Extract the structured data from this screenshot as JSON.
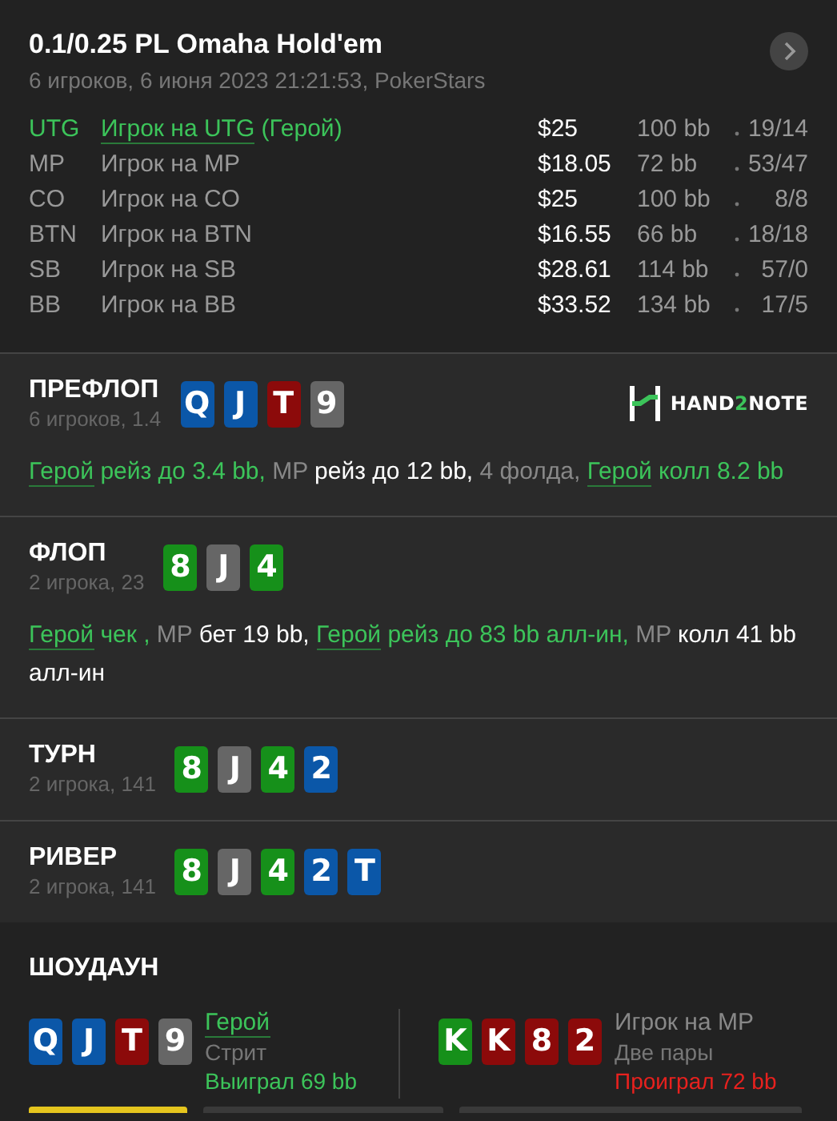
{
  "header": {
    "title": "0.1/0.25 PL Omaha Hold'em",
    "subtitle": "6 игроков, 6 июня 2023 21:21:53, PokerStars"
  },
  "players": [
    {
      "position": "UTG",
      "name": "Игрок на UTG",
      "suffix": "(Герой)",
      "hero": true,
      "stack": "$25",
      "bb": "100 bb",
      "stats": "19/14"
    },
    {
      "position": "MP",
      "name": "Игрок на MP",
      "hero": false,
      "stack": "$18.05",
      "bb": "72 bb",
      "stats": "53/47"
    },
    {
      "position": "CO",
      "name": "Игрок на CO",
      "hero": false,
      "stack": "$25",
      "bb": "100 bb",
      "stats": "8/8"
    },
    {
      "position": "BTN",
      "name": "Игрок на BTN",
      "hero": false,
      "stack": "$16.55",
      "bb": "66 bb",
      "stats": "18/18"
    },
    {
      "position": "SB",
      "name": "Игрок на SB",
      "hero": false,
      "stack": "$28.61",
      "bb": "114 bb",
      "stats": "57/0"
    },
    {
      "position": "BB",
      "name": "Игрок на BB",
      "hero": false,
      "stack": "$33.52",
      "bb": "134 bb",
      "stats": "17/5"
    }
  ],
  "streets": [
    {
      "name": "ПРЕФЛОП",
      "info": "6 игроков, 1.4",
      "logo": {
        "prefix": "HAND",
        "accent": "2",
        "suffix": "NOTE"
      },
      "cards": [
        {
          "rank": "Q",
          "color": "#0b57a8"
        },
        {
          "rank": "J",
          "color": "#0b57a8"
        },
        {
          "rank": "T",
          "color": "#8c0a0a"
        },
        {
          "rank": "9",
          "color": "#666666"
        }
      ],
      "actions": [
        {
          "kind": "link",
          "text": "Герой"
        },
        {
          "kind": "green",
          "text": " рейз до 3.4 bb,"
        },
        {
          "kind": "grey",
          "text": " MP"
        },
        {
          "kind": "white",
          "text": " рейз до 12 bb,"
        },
        {
          "kind": "grey",
          "text": " 4 фолда, "
        },
        {
          "kind": "link",
          "text": "Герой"
        },
        {
          "kind": "green",
          "text": " колл 8.2 bb"
        }
      ]
    },
    {
      "name": "ФЛОП",
      "info": "2 игрока, 23",
      "cards": [
        {
          "rank": "8",
          "color": "#16901a"
        },
        {
          "rank": "J",
          "color": "#666666"
        },
        {
          "rank": "4",
          "color": "#16901a"
        }
      ],
      "actions": [
        {
          "kind": "link",
          "text": "Герой"
        },
        {
          "kind": "green",
          "text": " чек ,"
        },
        {
          "kind": "grey",
          "text": " MP"
        },
        {
          "kind": "white",
          "text": " бет 19 bb, "
        },
        {
          "kind": "link",
          "text": "Герой"
        },
        {
          "kind": "green",
          "text": " рейз до 83 bb алл-ин,"
        },
        {
          "kind": "grey",
          "text": " MP"
        },
        {
          "kind": "white",
          "text": " колл 41 bb алл-ин"
        }
      ]
    },
    {
      "name": "ТУРН",
      "info": "2 игрока, 141",
      "cards": [
        {
          "rank": "8",
          "color": "#16901a"
        },
        {
          "rank": "J",
          "color": "#666666"
        },
        {
          "rank": "4",
          "color": "#16901a"
        },
        {
          "rank": "2",
          "color": "#0b57a8"
        }
      ]
    },
    {
      "name": "РИВЕР",
      "info": "2 игрока, 141",
      "cards": [
        {
          "rank": "8",
          "color": "#16901a"
        },
        {
          "rank": "J",
          "color": "#666666"
        },
        {
          "rank": "4",
          "color": "#16901a"
        },
        {
          "rank": "2",
          "color": "#0b57a8"
        },
        {
          "rank": "T",
          "color": "#0b57a8"
        }
      ]
    }
  ],
  "showdown": {
    "title": "ШОУДАУН",
    "hands": [
      {
        "player": "Герой",
        "hero": true,
        "hand": "Стрит",
        "result": "Выиграл 69 bb",
        "won": true,
        "cards": [
          {
            "rank": "Q",
            "color": "#0b57a8"
          },
          {
            "rank": "J",
            "color": "#0b57a8"
          },
          {
            "rank": "T",
            "color": "#8c0a0a"
          },
          {
            "rank": "9",
            "color": "#666666"
          }
        ]
      },
      {
        "player": "Игрок на MP",
        "hero": false,
        "hand": "Две пары",
        "result": "Проиграл 72 bb",
        "won": false,
        "cards": [
          {
            "rank": "K",
            "color": "#16901a"
          },
          {
            "rank": "K",
            "color": "#8c0a0a"
          },
          {
            "rank": "8",
            "color": "#8c0a0a"
          },
          {
            "rank": "2",
            "color": "#8c0a0a"
          }
        ]
      }
    ]
  }
}
